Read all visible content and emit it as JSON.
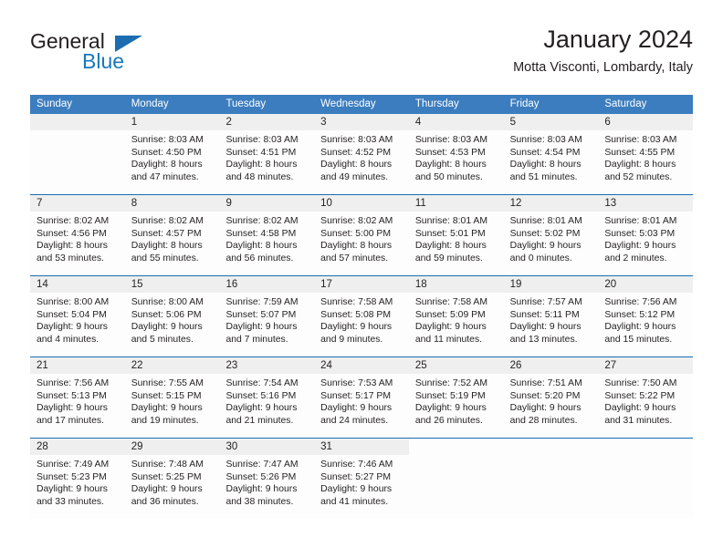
{
  "brand": {
    "name_top": "General",
    "name_bottom": "Blue",
    "accent_color": "#1b6cb0",
    "triangle_icon": "brand-triangle-icon"
  },
  "header": {
    "title": "January 2024",
    "location": "Motta Visconti, Lombardy, Italy"
  },
  "calendar": {
    "header_bg": "#3b7dbf",
    "separator_color": "#1b6cb0",
    "datenum_bg": "#efefef",
    "day_names": [
      "Sunday",
      "Monday",
      "Tuesday",
      "Wednesday",
      "Thursday",
      "Friday",
      "Saturday"
    ],
    "weeks": [
      [
        {
          "date": "",
          "lines": []
        },
        {
          "date": "1",
          "lines": [
            "Sunrise: 8:03 AM",
            "Sunset: 4:50 PM",
            "Daylight: 8 hours",
            "and 47 minutes."
          ]
        },
        {
          "date": "2",
          "lines": [
            "Sunrise: 8:03 AM",
            "Sunset: 4:51 PM",
            "Daylight: 8 hours",
            "and 48 minutes."
          ]
        },
        {
          "date": "3",
          "lines": [
            "Sunrise: 8:03 AM",
            "Sunset: 4:52 PM",
            "Daylight: 8 hours",
            "and 49 minutes."
          ]
        },
        {
          "date": "4",
          "lines": [
            "Sunrise: 8:03 AM",
            "Sunset: 4:53 PM",
            "Daylight: 8 hours",
            "and 50 minutes."
          ]
        },
        {
          "date": "5",
          "lines": [
            "Sunrise: 8:03 AM",
            "Sunset: 4:54 PM",
            "Daylight: 8 hours",
            "and 51 minutes."
          ]
        },
        {
          "date": "6",
          "lines": [
            "Sunrise: 8:03 AM",
            "Sunset: 4:55 PM",
            "Daylight: 8 hours",
            "and 52 minutes."
          ]
        }
      ],
      [
        {
          "date": "7",
          "lines": [
            "Sunrise: 8:02 AM",
            "Sunset: 4:56 PM",
            "Daylight: 8 hours",
            "and 53 minutes."
          ]
        },
        {
          "date": "8",
          "lines": [
            "Sunrise: 8:02 AM",
            "Sunset: 4:57 PM",
            "Daylight: 8 hours",
            "and 55 minutes."
          ]
        },
        {
          "date": "9",
          "lines": [
            "Sunrise: 8:02 AM",
            "Sunset: 4:58 PM",
            "Daylight: 8 hours",
            "and 56 minutes."
          ]
        },
        {
          "date": "10",
          "lines": [
            "Sunrise: 8:02 AM",
            "Sunset: 5:00 PM",
            "Daylight: 8 hours",
            "and 57 minutes."
          ]
        },
        {
          "date": "11",
          "lines": [
            "Sunrise: 8:01 AM",
            "Sunset: 5:01 PM",
            "Daylight: 8 hours",
            "and 59 minutes."
          ]
        },
        {
          "date": "12",
          "lines": [
            "Sunrise: 8:01 AM",
            "Sunset: 5:02 PM",
            "Daylight: 9 hours",
            "and 0 minutes."
          ]
        },
        {
          "date": "13",
          "lines": [
            "Sunrise: 8:01 AM",
            "Sunset: 5:03 PM",
            "Daylight: 9 hours",
            "and 2 minutes."
          ]
        }
      ],
      [
        {
          "date": "14",
          "lines": [
            "Sunrise: 8:00 AM",
            "Sunset: 5:04 PM",
            "Daylight: 9 hours",
            "and 4 minutes."
          ]
        },
        {
          "date": "15",
          "lines": [
            "Sunrise: 8:00 AM",
            "Sunset: 5:06 PM",
            "Daylight: 9 hours",
            "and 5 minutes."
          ]
        },
        {
          "date": "16",
          "lines": [
            "Sunrise: 7:59 AM",
            "Sunset: 5:07 PM",
            "Daylight: 9 hours",
            "and 7 minutes."
          ]
        },
        {
          "date": "17",
          "lines": [
            "Sunrise: 7:58 AM",
            "Sunset: 5:08 PM",
            "Daylight: 9 hours",
            "and 9 minutes."
          ]
        },
        {
          "date": "18",
          "lines": [
            "Sunrise: 7:58 AM",
            "Sunset: 5:09 PM",
            "Daylight: 9 hours",
            "and 11 minutes."
          ]
        },
        {
          "date": "19",
          "lines": [
            "Sunrise: 7:57 AM",
            "Sunset: 5:11 PM",
            "Daylight: 9 hours",
            "and 13 minutes."
          ]
        },
        {
          "date": "20",
          "lines": [
            "Sunrise: 7:56 AM",
            "Sunset: 5:12 PM",
            "Daylight: 9 hours",
            "and 15 minutes."
          ]
        }
      ],
      [
        {
          "date": "21",
          "lines": [
            "Sunrise: 7:56 AM",
            "Sunset: 5:13 PM",
            "Daylight: 9 hours",
            "and 17 minutes."
          ]
        },
        {
          "date": "22",
          "lines": [
            "Sunrise: 7:55 AM",
            "Sunset: 5:15 PM",
            "Daylight: 9 hours",
            "and 19 minutes."
          ]
        },
        {
          "date": "23",
          "lines": [
            "Sunrise: 7:54 AM",
            "Sunset: 5:16 PM",
            "Daylight: 9 hours",
            "and 21 minutes."
          ]
        },
        {
          "date": "24",
          "lines": [
            "Sunrise: 7:53 AM",
            "Sunset: 5:17 PM",
            "Daylight: 9 hours",
            "and 24 minutes."
          ]
        },
        {
          "date": "25",
          "lines": [
            "Sunrise: 7:52 AM",
            "Sunset: 5:19 PM",
            "Daylight: 9 hours",
            "and 26 minutes."
          ]
        },
        {
          "date": "26",
          "lines": [
            "Sunrise: 7:51 AM",
            "Sunset: 5:20 PM",
            "Daylight: 9 hours",
            "and 28 minutes."
          ]
        },
        {
          "date": "27",
          "lines": [
            "Sunrise: 7:50 AM",
            "Sunset: 5:22 PM",
            "Daylight: 9 hours",
            "and 31 minutes."
          ]
        }
      ],
      [
        {
          "date": "28",
          "lines": [
            "Sunrise: 7:49 AM",
            "Sunset: 5:23 PM",
            "Daylight: 9 hours",
            "and 33 minutes."
          ]
        },
        {
          "date": "29",
          "lines": [
            "Sunrise: 7:48 AM",
            "Sunset: 5:25 PM",
            "Daylight: 9 hours",
            "and 36 minutes."
          ]
        },
        {
          "date": "30",
          "lines": [
            "Sunrise: 7:47 AM",
            "Sunset: 5:26 PM",
            "Daylight: 9 hours",
            "and 38 minutes."
          ]
        },
        {
          "date": "31",
          "lines": [
            "Sunrise: 7:46 AM",
            "Sunset: 5:27 PM",
            "Daylight: 9 hours",
            "and 41 minutes."
          ]
        },
        {
          "date": "",
          "lines": [],
          "blank": true
        },
        {
          "date": "",
          "lines": [],
          "blank": true
        },
        {
          "date": "",
          "lines": [],
          "blank": true
        }
      ]
    ]
  }
}
